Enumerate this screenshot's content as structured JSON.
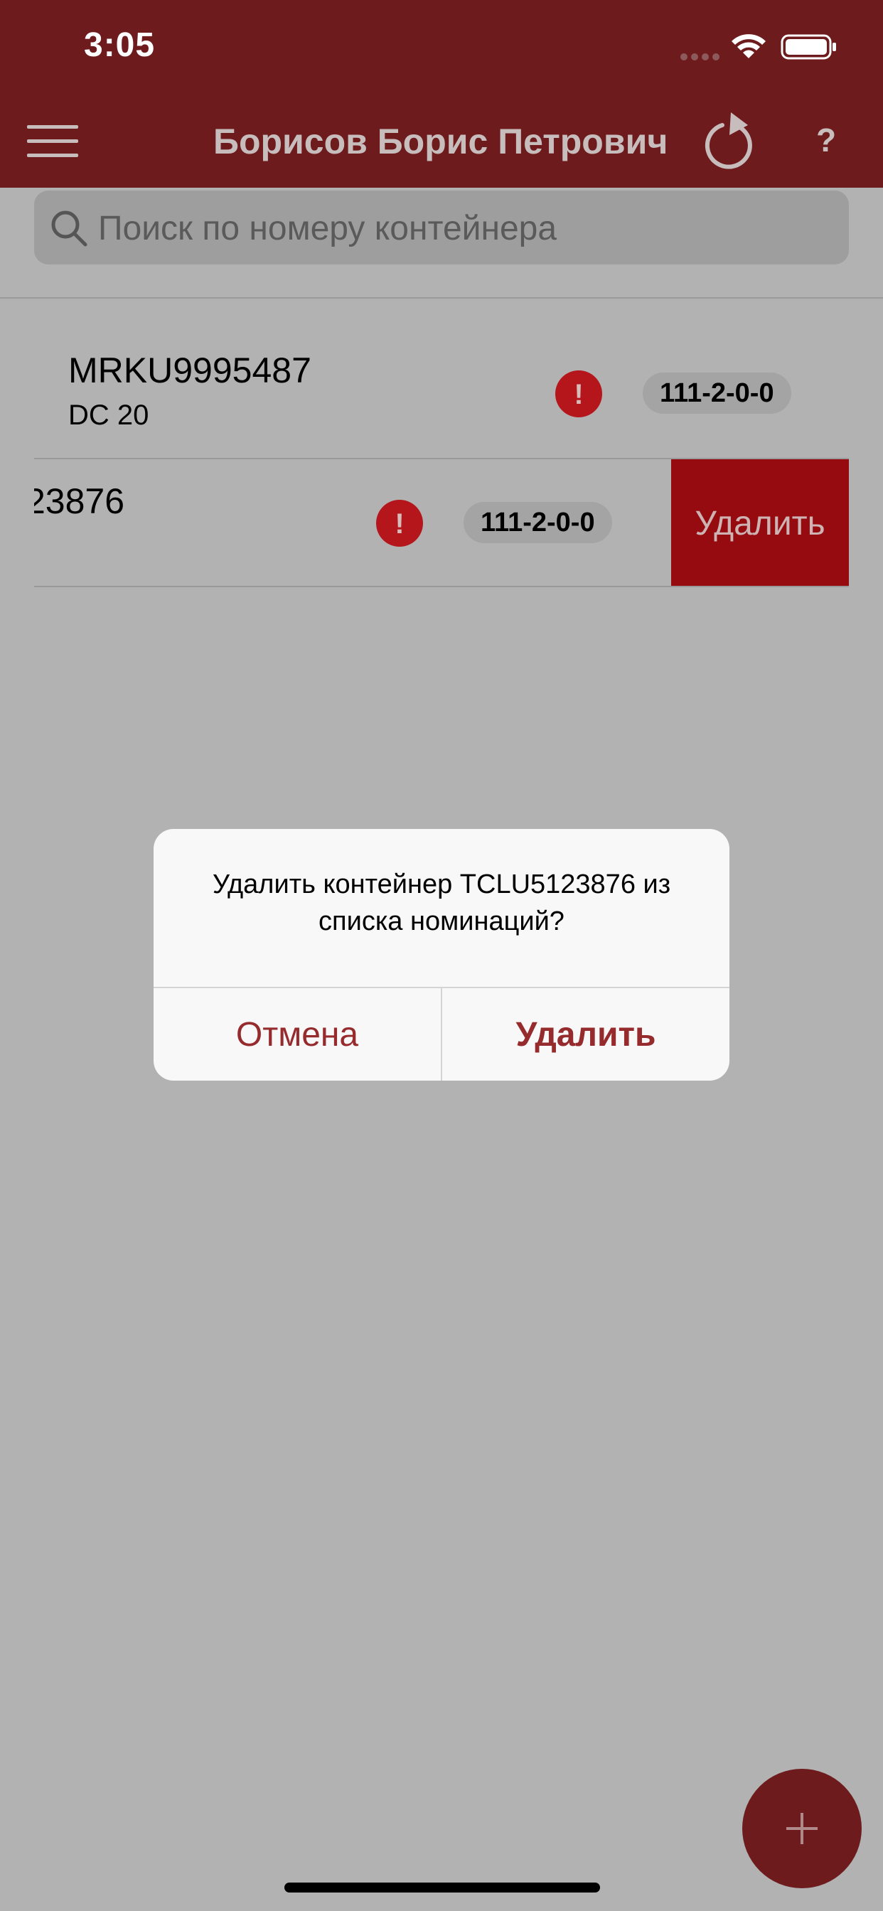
{
  "status_bar": {
    "time": "3:05"
  },
  "nav": {
    "title": "Борисов Борис Петрович",
    "help_label": "?"
  },
  "search": {
    "placeholder": "Поиск по номеру контейнера"
  },
  "list": {
    "items": [
      {
        "number": "MRKU9995487",
        "type": "DC 20",
        "code": "111-2-0-0"
      },
      {
        "number": "TCLU5123876",
        "visible_number": "23876",
        "code": "111-2-0-0"
      }
    ],
    "swipe_action_label": "Удалить",
    "alert_glyph": "!"
  },
  "dialog": {
    "message": "Удалить контейнер TCLU5123876 из списка номинаций?",
    "cancel_label": "Отмена",
    "confirm_label": "Удалить"
  },
  "fab": {
    "label": "+"
  },
  "colors": {
    "brand": "#6e1b1e",
    "destructive": "#960b0f",
    "alert": "#b5161b",
    "dialog_text": "#962b2d"
  },
  "icons": [
    "menu-icon",
    "refresh-icon",
    "search-icon",
    "alert-icon",
    "wifi-icon",
    "battery-icon",
    "plus-icon"
  ]
}
